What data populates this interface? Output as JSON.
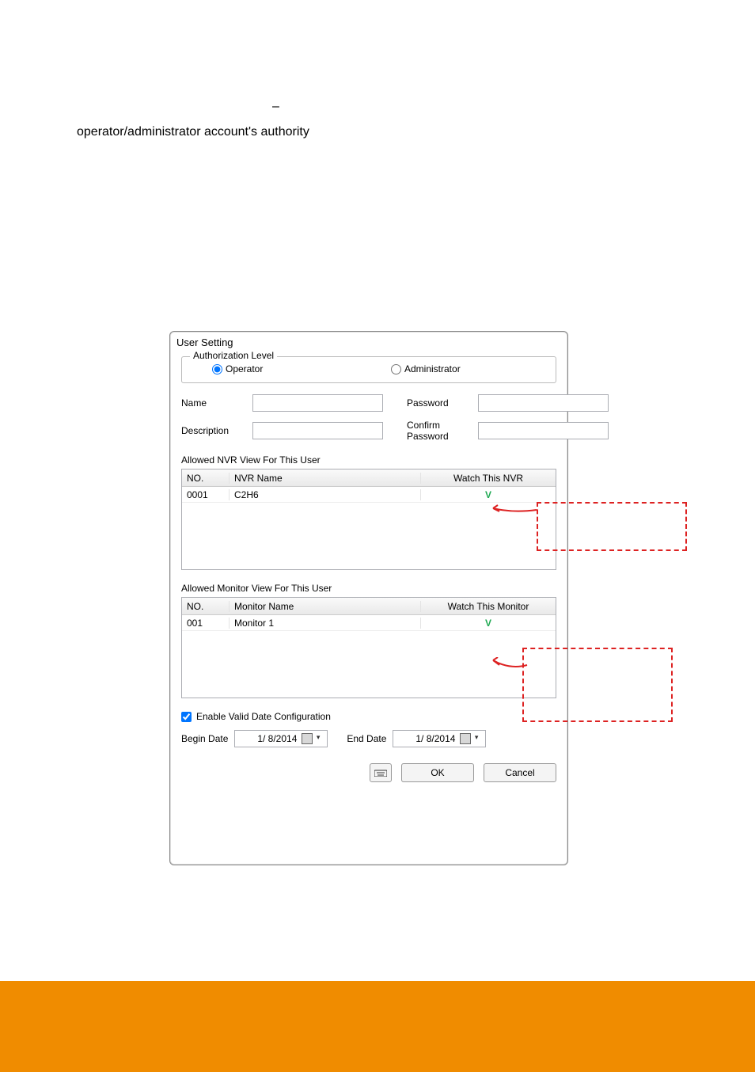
{
  "doc": {
    "dash": "–",
    "heading": "operator/administrator account's authority"
  },
  "window": {
    "title": "User Setting",
    "authorization": {
      "legend": "Authorization Level",
      "operator": "Operator",
      "administrator": "Administrator"
    },
    "fields": {
      "name": "Name",
      "description": "Description",
      "password": "Password",
      "confirm": "Confirm Password",
      "name_value": "",
      "description_value": "",
      "password_value": "",
      "confirm_value": ""
    },
    "nvr_section": {
      "label": "Allowed NVR View For This User",
      "columns": {
        "no": "NO.",
        "name": "NVR Name",
        "watch": "Watch This NVR"
      },
      "rows": [
        {
          "no": "0001",
          "name": "C2H6",
          "watch": "V"
        }
      ]
    },
    "monitor_section": {
      "label": "Allowed Monitor View For This User",
      "columns": {
        "no": "NO.",
        "name": "Monitor Name",
        "watch": "Watch This Monitor"
      },
      "rows": [
        {
          "no": "001",
          "name": "Monitor 1",
          "watch": "V"
        }
      ]
    },
    "valid_date": {
      "checkbox": "Enable Valid Date Configuration",
      "begin_label": "Begin Date",
      "begin_value": "1/ 8/2014",
      "end_label": "End Date",
      "end_value": "1/ 8/2014"
    },
    "buttons": {
      "ok": "OK",
      "cancel": "Cancel"
    }
  }
}
